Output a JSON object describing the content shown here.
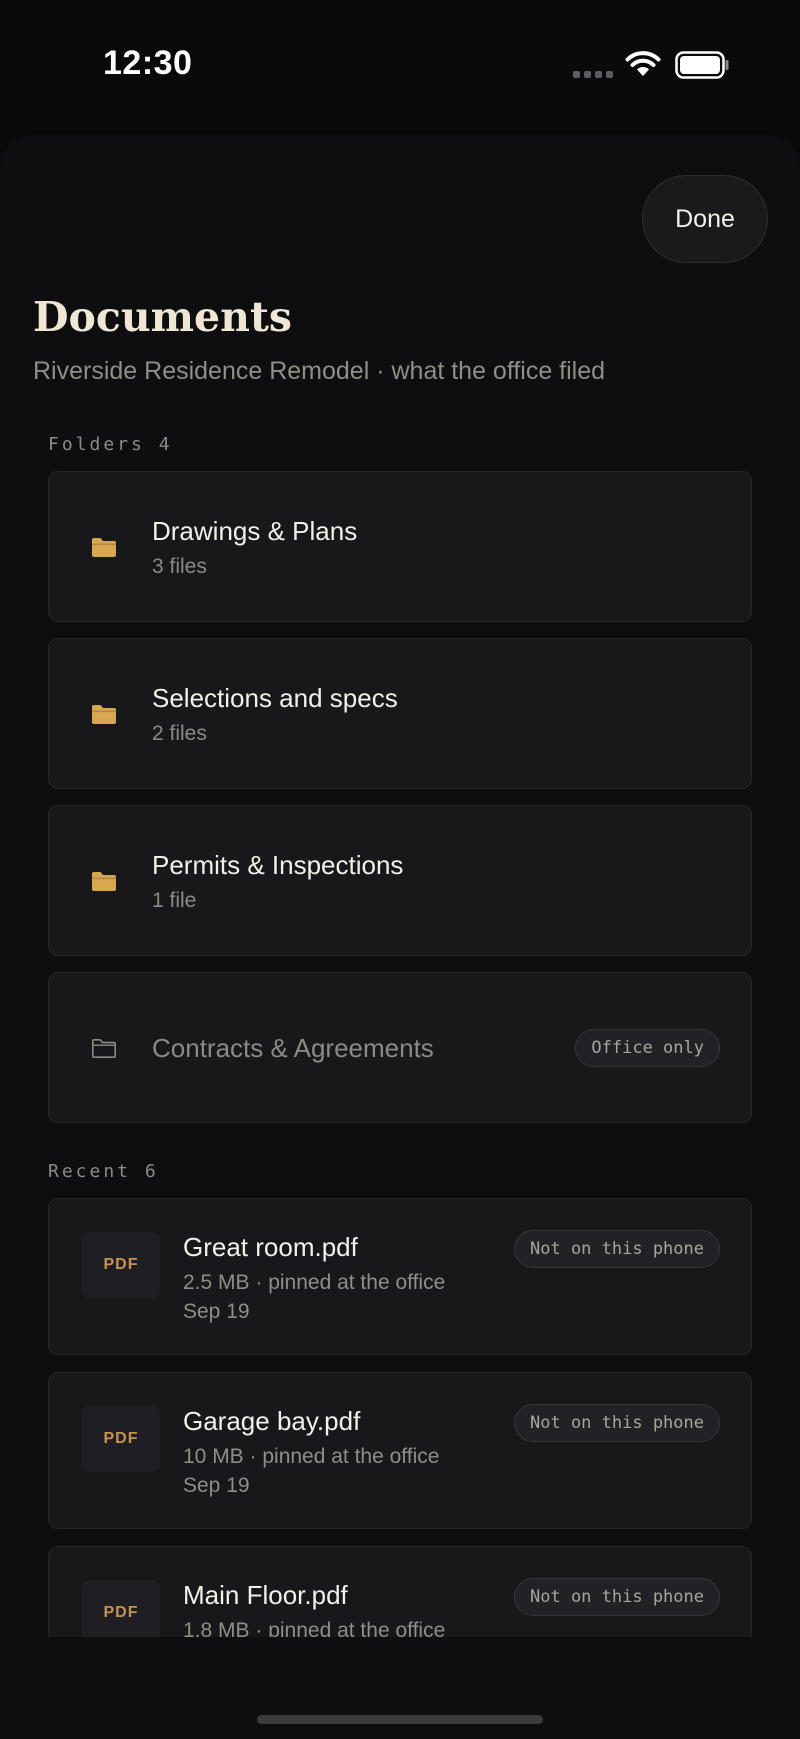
{
  "status_bar": {
    "time": "12:30"
  },
  "header": {
    "done_label": "Done",
    "title": "Documents",
    "subtitle": "Riverside Residence Remodel · what the office filed"
  },
  "folders": {
    "label": "Folders 4",
    "items": [
      {
        "name": "Drawings & Plans",
        "count": "3 files"
      },
      {
        "name": "Selections and specs",
        "count": "2 files"
      },
      {
        "name": "Permits & Inspections",
        "count": "1 file"
      },
      {
        "name": "Contracts & Agreements",
        "badge": "Office only"
      }
    ]
  },
  "recent": {
    "label": "Recent 6",
    "items": [
      {
        "type": "PDF",
        "name": "Great room.pdf",
        "meta": "2.5 MB · pinned at the office",
        "date": "Sep 19",
        "badge": "Not on this phone"
      },
      {
        "type": "PDF",
        "name": "Garage bay.pdf",
        "meta": "10 MB · pinned at the office",
        "date": "Sep 19",
        "badge": "Not on this phone"
      },
      {
        "type": "PDF",
        "name": "Main Floor.pdf",
        "meta": "1.8 MB · pinned at the office",
        "badge": "Not on this phone"
      }
    ]
  },
  "colors": {
    "accent": "#d9a651",
    "background": "#0e0e10",
    "card": "#18181b"
  },
  "icons": [
    "folder-icon",
    "folder-outline-icon",
    "wifi-icon",
    "battery-icon",
    "signal-icon"
  ]
}
